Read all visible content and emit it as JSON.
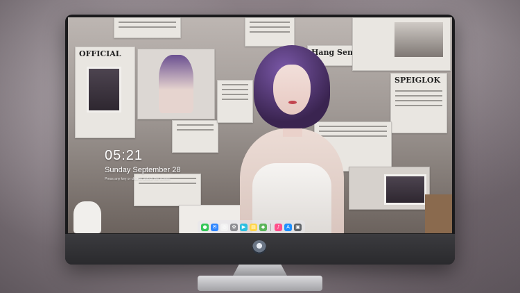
{
  "lockscreen": {
    "time": "05:21",
    "date": "Sunday September 28",
    "hint": "Press any key or click to unlock the screen"
  },
  "wallpaper": {
    "headlines": [
      "OFFICIAL",
      "Hang Seng",
      "SPEIGLOK"
    ]
  },
  "dock": {
    "apps": [
      {
        "name": "messages-icon",
        "glyph": "●",
        "color": "#34c759"
      },
      {
        "name": "mail-icon",
        "glyph": "✉",
        "color": "#2f86ff"
      },
      {
        "name": "safari-icon",
        "glyph": "◎",
        "color": "#f2f2f2"
      },
      {
        "name": "photos-icon",
        "glyph": "✿",
        "color": "#8e8e93"
      },
      {
        "name": "facetime-icon",
        "glyph": "▶",
        "color": "#2bbfe0"
      },
      {
        "name": "notes-icon",
        "glyph": "▤",
        "color": "#ffd54a"
      },
      {
        "name": "maps-icon",
        "glyph": "◆",
        "color": "#5ab45a"
      },
      {
        "name": "music-icon",
        "glyph": "♪",
        "color": "#ff4f8b"
      },
      {
        "name": "app-store-icon",
        "glyph": "A",
        "color": "#1e90ff"
      },
      {
        "name": "trash-icon",
        "glyph": "▣",
        "color": "#5f6368"
      }
    ]
  }
}
